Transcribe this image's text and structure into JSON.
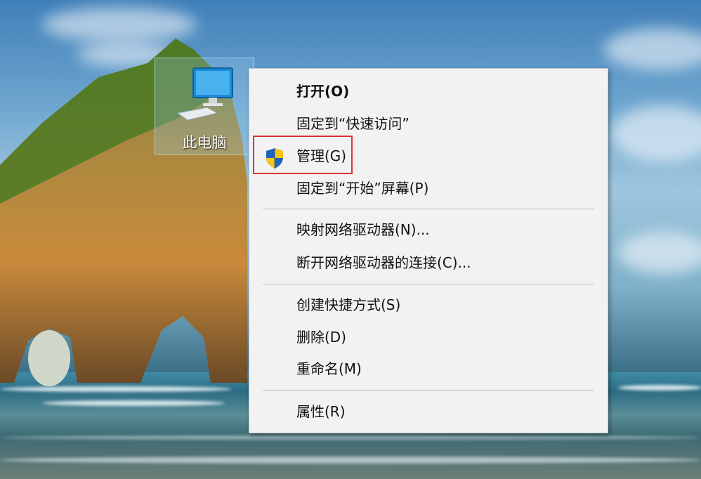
{
  "desktop": {
    "icon": {
      "label": "此电脑",
      "icon": "computer-icon"
    }
  },
  "context_menu": {
    "items": [
      {
        "label": "打开(O)",
        "bold": true
      },
      {
        "label": "固定到“快速访问”"
      },
      {
        "label": "管理(G)",
        "icon": "shield-icon",
        "highlighted": true
      },
      {
        "label": "固定到“开始”屏幕(P)"
      },
      {
        "label": "映射网络驱动器(N)..."
      },
      {
        "label": "断开网络驱动器的连接(C)..."
      },
      {
        "label": "创建快捷方式(S)"
      },
      {
        "label": "删除(D)"
      },
      {
        "label": "重命名(M)"
      },
      {
        "label": "属性(R)"
      }
    ],
    "highlight_color": "#d9333a"
  }
}
